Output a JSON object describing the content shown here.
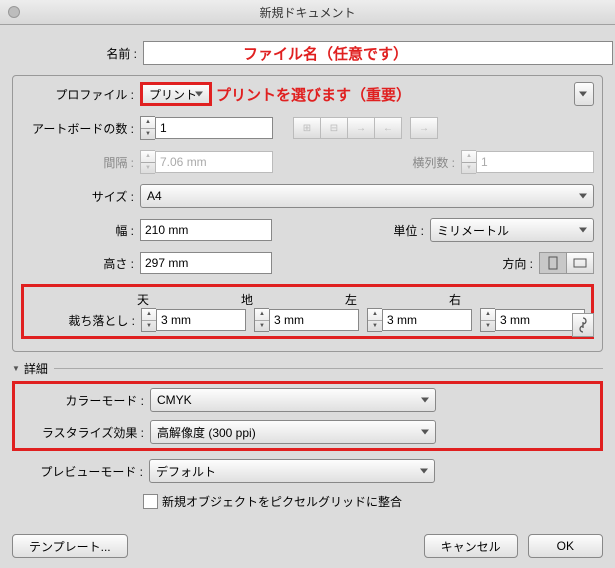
{
  "window": {
    "title": "新規ドキュメント"
  },
  "name": {
    "label": "名前 :",
    "value": "",
    "annot": "ファイル名（任意です）"
  },
  "profile": {
    "label": "プロファイル :",
    "value": "プリント",
    "annot": "プリントを選びます（重要）"
  },
  "artboards": {
    "label": "アートボードの数 :",
    "value": "1"
  },
  "spacing": {
    "label": "間隔 :",
    "value": "7.06 mm"
  },
  "columns": {
    "label": "横列数 :",
    "value": "1"
  },
  "size": {
    "label": "サイズ :",
    "value": "A4"
  },
  "width": {
    "label": "幅 :",
    "value": "210 mm"
  },
  "unit": {
    "label": "単位 :",
    "value": "ミリメートル"
  },
  "height": {
    "label": "高さ :",
    "value": "297 mm"
  },
  "orient": {
    "label": "方向 :"
  },
  "bleed": {
    "label": "裁ち落とし :",
    "top": {
      "label": "天",
      "value": "3 mm"
    },
    "bottom": {
      "label": "地",
      "value": "3 mm"
    },
    "left": {
      "label": "左",
      "value": "3 mm"
    },
    "right": {
      "label": "右",
      "value": "3 mm"
    }
  },
  "advanced": {
    "label": "詳細"
  },
  "colormode": {
    "label": "カラーモード :",
    "value": "CMYK"
  },
  "raster": {
    "label": "ラスタライズ効果 :",
    "value": "高解像度 (300 ppi)"
  },
  "preview": {
    "label": "プレビューモード :",
    "value": "デフォルト"
  },
  "pixelgrid": {
    "label": "新規オブジェクトをピクセルグリッドに整合"
  },
  "buttons": {
    "template": "テンプレート...",
    "cancel": "キャンセル",
    "ok": "OK"
  }
}
